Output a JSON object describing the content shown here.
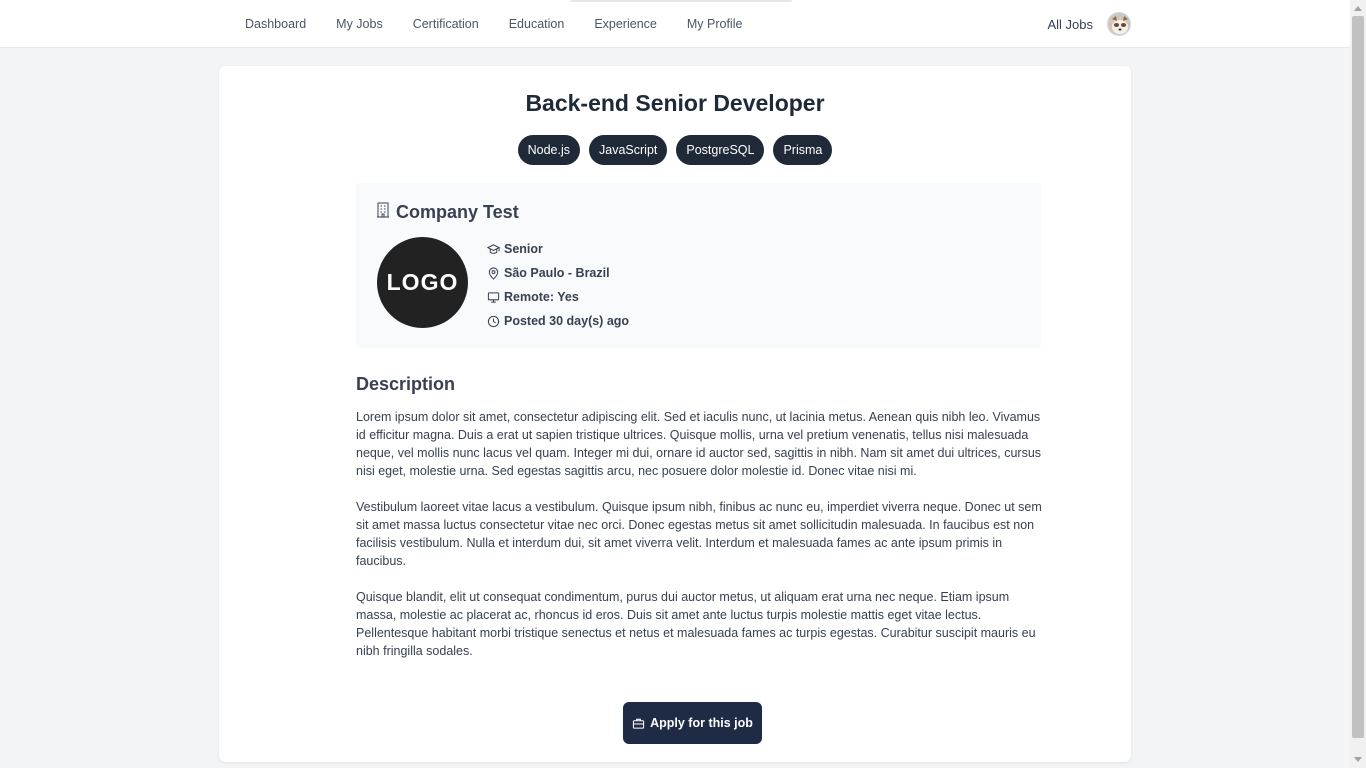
{
  "nav": {
    "items": [
      {
        "label": "Dashboard"
      },
      {
        "label": "My Jobs"
      },
      {
        "label": "Certification"
      },
      {
        "label": "Education"
      },
      {
        "label": "Experience"
      },
      {
        "label": "My Profile"
      }
    ],
    "all_jobs_label": "All Jobs"
  },
  "job": {
    "title": "Back-end Senior Developer",
    "tags": [
      "Node.js",
      "JavaScript",
      "PostgreSQL",
      "Prisma"
    ],
    "company": {
      "name": "Company Test",
      "logo_text": "LOGO",
      "level": "Senior",
      "location": "São Paulo - Brazil",
      "remote": "Remote: Yes",
      "posted": "Posted 30 day(s) ago"
    },
    "description_title": "Description",
    "description": [
      "Lorem ipsum dolor sit amet, consectetur adipiscing elit. Sed et iaculis nunc, ut lacinia metus. Aenean quis nibh leo. Vivamus id efficitur magna. Duis a erat ut sapien tristique ultrices. Quisque mollis, urna vel pretium venenatis, tellus nisi malesuada neque, vel mollis nunc lacus vel quam. Integer mi dui, ornare id auctor sed, sagittis in nibh. Nam sit amet dui ultrices, cursus nisi eget, molestie urna. Sed egestas sagittis arcu, nec posuere dolor molestie id. Donec vitae nisi mi.",
      "Vestibulum laoreet vitae lacus a vestibulum. Quisque ipsum nibh, finibus ac nunc eu, imperdiet viverra neque. Donec ut sem sit amet massa luctus consectetur vitae nec orci. Donec egestas metus sit amet sollicitudin malesuada. In faucibus est non facilisis vestibulum. Nulla et interdum dui, sit amet viverra velit. Interdum et malesuada fames ac ante ipsum primis in faucibus.",
      "Quisque blandit, elit ut consequat condimentum, purus dui auctor metus, ut aliquam erat urna nec neque. Etiam ipsum massa, molestie ac placerat ac, rhoncus id eros. Duis sit amet ante luctus turpis molestie mattis eget vitae lectus. Pellentesque habitant morbi tristique senectus et netus et malesuada fames ac turpis egestas. Curabitur suscipit mauris eu nibh fringilla sodales."
    ],
    "apply_label": "Apply for this job"
  },
  "colors": {
    "page_background": "#f3f4f6",
    "tag_background": "#1f2937",
    "apply_background": "#1f2a44",
    "logo_background": "#222222"
  },
  "icons": [
    "building-icon",
    "graduation-cap-icon",
    "map-pin-icon",
    "monitor-icon",
    "clock-icon",
    "briefcase-icon"
  ]
}
